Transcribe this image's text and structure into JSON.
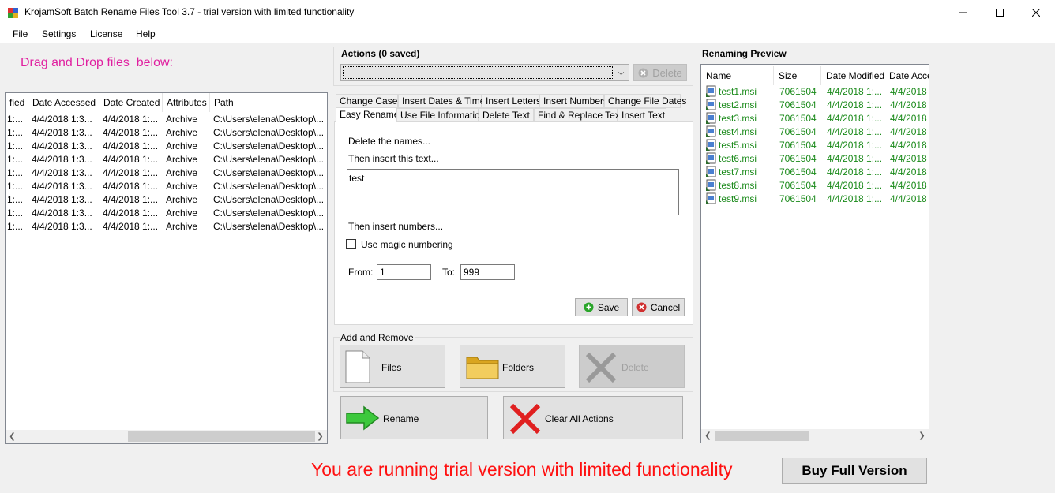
{
  "window": {
    "title": "KrojamSoft Batch Rename Files Tool 3.7 - trial version with limited functionality"
  },
  "menu": [
    "File",
    "Settings",
    "License",
    "Help"
  ],
  "drag_drop_label": "Drag and Drop files  below:",
  "file_list": {
    "columns": [
      "fied",
      "Date Accessed",
      "Date Created",
      "Attributes",
      "Path"
    ],
    "rows": [
      [
        "1:...",
        "4/4/2018 1:3...",
        "4/4/2018 1:...",
        "Archive",
        "C:\\Users\\elena\\Desktop\\..."
      ],
      [
        "1:...",
        "4/4/2018 1:3...",
        "4/4/2018 1:...",
        "Archive",
        "C:\\Users\\elena\\Desktop\\..."
      ],
      [
        "1:...",
        "4/4/2018 1:3...",
        "4/4/2018 1:...",
        "Archive",
        "C:\\Users\\elena\\Desktop\\..."
      ],
      [
        "1:...",
        "4/4/2018 1:3...",
        "4/4/2018 1:...",
        "Archive",
        "C:\\Users\\elena\\Desktop\\..."
      ],
      [
        "1:...",
        "4/4/2018 1:3...",
        "4/4/2018 1:...",
        "Archive",
        "C:\\Users\\elena\\Desktop\\..."
      ],
      [
        "1:...",
        "4/4/2018 1:3...",
        "4/4/2018 1:...",
        "Archive",
        "C:\\Users\\elena\\Desktop\\..."
      ],
      [
        "1:...",
        "4/4/2018 1:3...",
        "4/4/2018 1:...",
        "Archive",
        "C:\\Users\\elena\\Desktop\\..."
      ],
      [
        "1:...",
        "4/4/2018 1:3...",
        "4/4/2018 1:...",
        "Archive",
        "C:\\Users\\elena\\Desktop\\..."
      ],
      [
        "1:...",
        "4/4/2018 1:3...",
        "4/4/2018 1:...",
        "Archive",
        "C:\\Users\\elena\\Desktop\\..."
      ]
    ]
  },
  "actions": {
    "title": "Actions (0 saved)",
    "delete_label": "Delete"
  },
  "tabs": {
    "row1": [
      "Change Case",
      "Insert Dates & Times",
      "Insert Letters",
      "Insert Numbers",
      "Change File Dates"
    ],
    "row2": [
      "Easy Rename",
      "Use File Information",
      "Delete Text",
      "Find & Replace Text",
      "Insert Text"
    ],
    "active": "Easy Rename"
  },
  "easy_rename": {
    "delete_names": "Delete the names...",
    "insert_text_label": "Then insert this text...",
    "insert_text_value": "test",
    "insert_numbers_label": "Then insert numbers...",
    "magic_numbering_label": "Use magic numbering",
    "magic_numbering_checked": false,
    "from_label": "From:",
    "from_value": "1",
    "to_label": "To:",
    "to_value": "999",
    "save_label": "Save",
    "cancel_label": "Cancel"
  },
  "add_remove": {
    "title": "Add and Remove",
    "files_label": "Files",
    "folders_label": "Folders",
    "delete_label": "Delete"
  },
  "rename_label": "Rename",
  "clear_actions_label": "Clear All Actions",
  "preview": {
    "title": "Renaming Preview",
    "columns": [
      "Name",
      "Size",
      "Date Modified",
      "Date Acce"
    ],
    "rows": [
      [
        "test1.msi",
        "7061504",
        "4/4/2018 1:...",
        "4/4/2018"
      ],
      [
        "test2.msi",
        "7061504",
        "4/4/2018 1:...",
        "4/4/2018"
      ],
      [
        "test3.msi",
        "7061504",
        "4/4/2018 1:...",
        "4/4/2018"
      ],
      [
        "test4.msi",
        "7061504",
        "4/4/2018 1:...",
        "4/4/2018"
      ],
      [
        "test5.msi",
        "7061504",
        "4/4/2018 1:...",
        "4/4/2018"
      ],
      [
        "test6.msi",
        "7061504",
        "4/4/2018 1:...",
        "4/4/2018"
      ],
      [
        "test7.msi",
        "7061504",
        "4/4/2018 1:...",
        "4/4/2018"
      ],
      [
        "test8.msi",
        "7061504",
        "4/4/2018 1:...",
        "4/4/2018"
      ],
      [
        "test9.msi",
        "7061504",
        "4/4/2018 1:...",
        "4/4/2018"
      ]
    ]
  },
  "trial_message": "You are running trial version with limited functionality",
  "buy_label": "Buy Full Version",
  "colors": {
    "trial_red": "#ff1010",
    "drag_pink": "#e020a0",
    "preview_green": "#1a8a1a"
  }
}
